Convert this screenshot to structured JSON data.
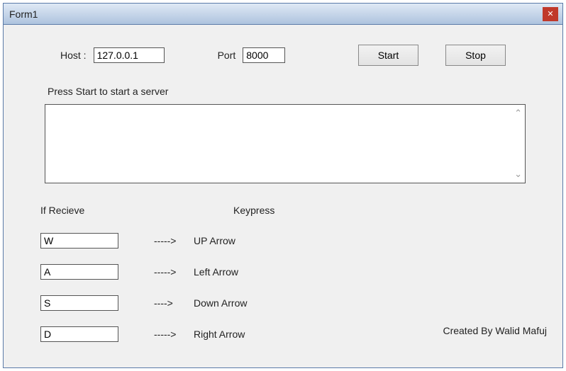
{
  "window": {
    "title": "Form1"
  },
  "top": {
    "host_label": "Host :",
    "host_value": "127.0.0.1",
    "port_label": "Port",
    "port_value": "8000",
    "start_label": "Start",
    "stop_label": "Stop"
  },
  "status": "Press Start to start a server",
  "log_value": "",
  "headers": {
    "recv": "If Recieve",
    "key": "Keypress"
  },
  "mappings": [
    {
      "recv": "W",
      "arrow": "----->",
      "key": "UP Arrow"
    },
    {
      "recv": "A",
      "arrow": "----->",
      "key": "Left Arrow"
    },
    {
      "recv": "S",
      "arrow": "---->",
      "key": "Down Arrow"
    },
    {
      "recv": "D",
      "arrow": "----->",
      "key": "Right Arrow"
    }
  ],
  "credit": "Created By Walid Mafuj"
}
